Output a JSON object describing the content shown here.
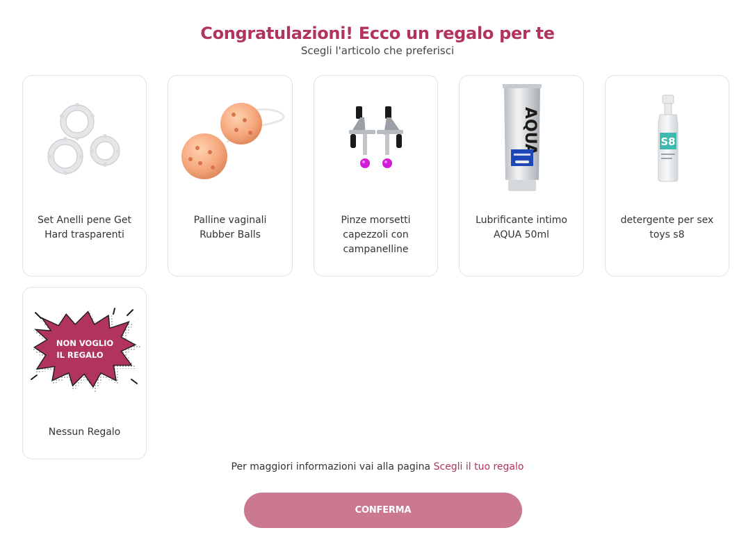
{
  "header": {
    "title": "Congratulazioni! Ecco un regalo per te",
    "subtitle": "Scegli l'articolo che preferisci"
  },
  "gifts": [
    {
      "label": "Set Anelli pene Get Hard trasparenti",
      "icon": "clear-rings-image"
    },
    {
      "label": "Palline vaginali Rubber Balls",
      "icon": "peach-balls-image"
    },
    {
      "label": "Pinze morsetti capezzoli con campanelline",
      "icon": "clamps-image"
    },
    {
      "label": "Lubrificante intimo AQUA 50ml",
      "icon": "aqua-tube-image",
      "product_text": "AQUA"
    },
    {
      "label": "detergente per sex toys s8",
      "icon": "s8-spray-bottle-image",
      "product_text": "S8"
    },
    {
      "label": "Nessun Regalo",
      "icon": "no-gift-burst-image",
      "badge_line1": "NON VOGLIO",
      "badge_line2": "IL REGALO"
    }
  ],
  "footer": {
    "info_text": "Per maggiori informazioni vai alla pagina ",
    "link_text": "Scegli il tuo regalo",
    "confirm_label": "CONFERMA"
  },
  "colors": {
    "brand": "#b0345f",
    "button": "#cb7891",
    "card_border": "#e1e1e1"
  }
}
